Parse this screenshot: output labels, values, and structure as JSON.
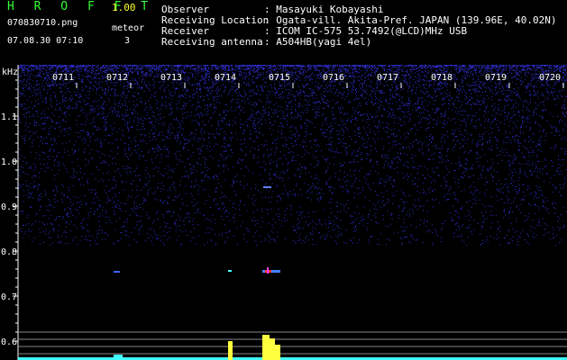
{
  "header": {
    "app_name": "H R O F F T",
    "version": "1.00",
    "filename": "070830710.png",
    "datetime": "07.08.30 07:10",
    "meteor_label": "meteor",
    "meteor_count": "3",
    "fields": [
      {
        "label": "Observer",
        "value": ": Masayuki Kobayashi"
      },
      {
        "label": "Receiving Location",
        "value": ": Ogata-vill. Akita-Pref. JAPAN (139.96E, 40.02N)"
      },
      {
        "label": "Receiver",
        "value": ": ICOM IC-575 53.7492(@LCD)MHz USB"
      },
      {
        "label": "Receiving antenna",
        "value": ": A504HB(yagi 4el)"
      }
    ]
  },
  "spectrogram": {
    "y_unit": "kHz",
    "y_ticks": [
      "1.1",
      "1.0",
      "0.9",
      "0.8",
      "0.7",
      "0.6"
    ],
    "time_ticks": [
      "0711",
      "0712",
      "0713",
      "0714",
      "0715",
      "0716",
      "0717",
      "0718",
      "0719",
      "0720"
    ],
    "colors": {
      "noise": "#3a3aff",
      "axis": "#ffffff",
      "label": "#ffffff",
      "echo": "#ff3030",
      "bar": "#ffff40",
      "bar_low": "#40ffff"
    }
  }
}
